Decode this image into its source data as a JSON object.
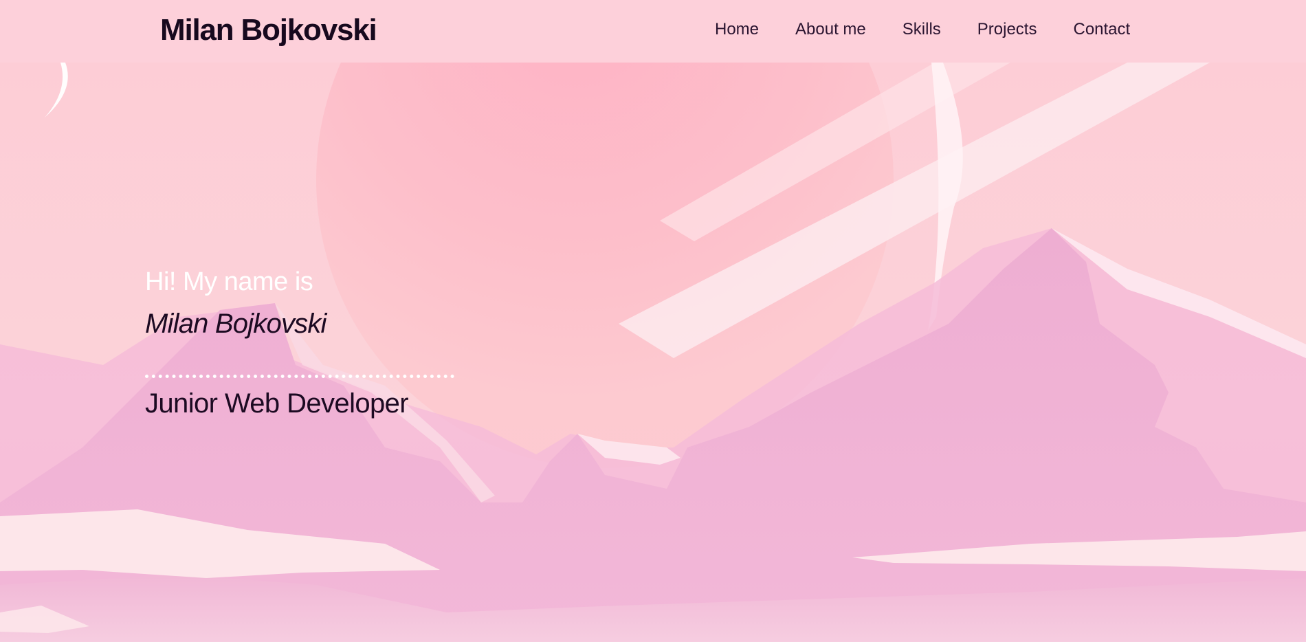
{
  "header": {
    "brand": "Milan Bojkovski",
    "nav": [
      {
        "label": "Home"
      },
      {
        "label": "About me"
      },
      {
        "label": "Skills"
      },
      {
        "label": "Projects"
      },
      {
        "label": "Contact"
      }
    ]
  },
  "hero": {
    "greeting": "Hi! My name is",
    "name": "Milan Bojkovski",
    "role": "Junior Web Developer"
  },
  "colors": {
    "header_bg": "#fdd0da",
    "sky": "#fcd0d9",
    "text_dark": "#1c0a22",
    "text_light": "#ffffff",
    "mountain": "#eeaed2"
  }
}
